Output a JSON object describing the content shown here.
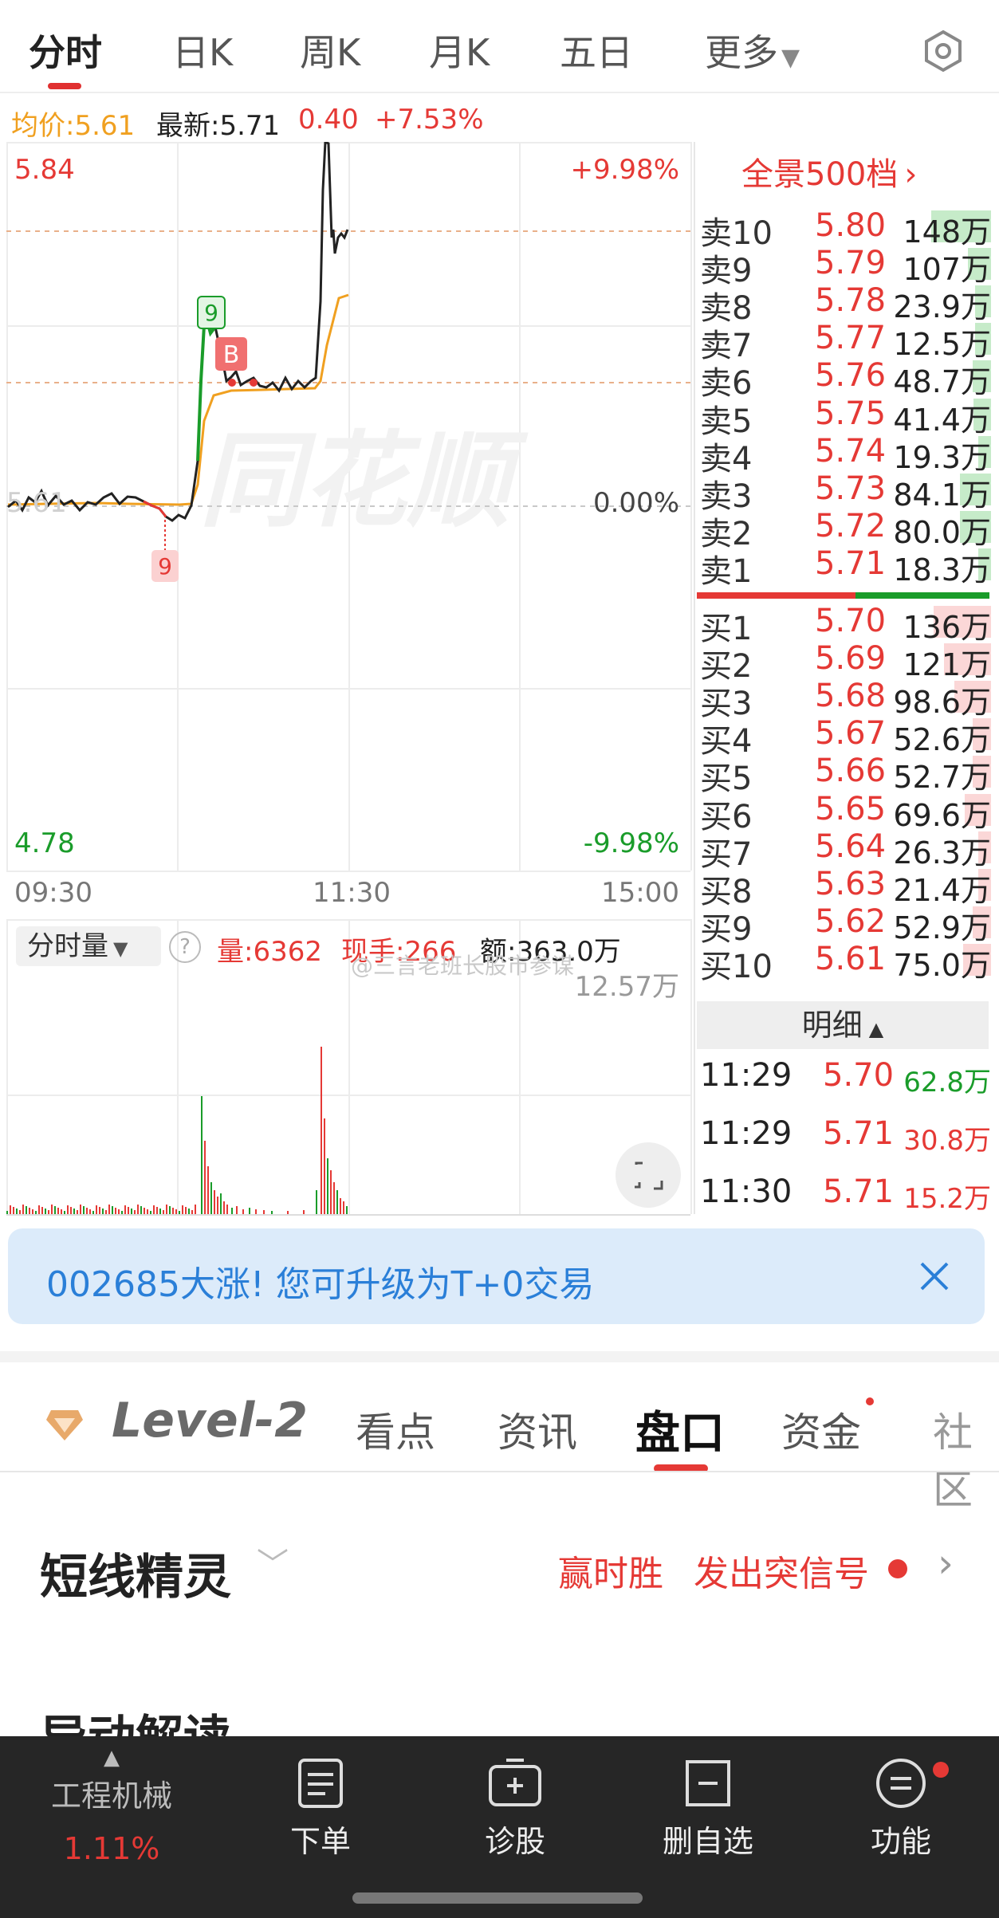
{
  "top_tabs": [
    "分时",
    "日K",
    "周K",
    "月K",
    "五日",
    "更多"
  ],
  "info": {
    "avg_label": "均价:5.61",
    "latest_label": "最新:5.71",
    "change": "0.40",
    "change_pct": "+7.53%"
  },
  "chart": {
    "y_high": "5.84",
    "y_low": "4.78",
    "pct_high": "+9.98%",
    "pct_low": "-9.98%",
    "pct_zero": "0.00%",
    "prev_close": "5.61",
    "x_labels": [
      "09:30",
      "11:30",
      "15:00"
    ],
    "marker_sell": "9",
    "marker_buy": "B",
    "marker_low": "9",
    "watermark": "同花顺"
  },
  "volume": {
    "selector": "分时量",
    "help": "?",
    "vol_label": "量:6362",
    "hand_label": "现手:266",
    "amount_label": "额:363.0万",
    "max_label": "12.57万",
    "watermark": "@三言老班长股市参谋"
  },
  "book": {
    "title": "全景500档",
    "asks": [
      {
        "name": "卖10",
        "price": "5.80",
        "vol": "148万",
        "bar": 0.58
      },
      {
        "name": "卖9",
        "price": "5.79",
        "vol": "107万",
        "bar": 0.22
      },
      {
        "name": "卖8",
        "price": "5.78",
        "vol": "23.9万",
        "bar": 0.15
      },
      {
        "name": "卖7",
        "price": "5.77",
        "vol": "12.5万",
        "bar": 0.15
      },
      {
        "name": "卖6",
        "price": "5.76",
        "vol": "48.7万",
        "bar": 0.18
      },
      {
        "name": "卖5",
        "price": "5.75",
        "vol": "41.4万",
        "bar": 0.17
      },
      {
        "name": "卖4",
        "price": "5.74",
        "vol": "19.3万",
        "bar": 0.12
      },
      {
        "name": "卖3",
        "price": "5.73",
        "vol": "84.1万",
        "bar": 0.3
      },
      {
        "name": "卖2",
        "price": "5.72",
        "vol": "80.0万",
        "bar": 0.3
      },
      {
        "name": "卖1",
        "price": "5.71",
        "vol": "18.3万",
        "bar": 0.12
      }
    ],
    "bids": [
      {
        "name": "买1",
        "price": "5.70",
        "vol": "136万",
        "bar": 0.55
      },
      {
        "name": "买2",
        "price": "5.69",
        "vol": "121万",
        "bar": 0.45
      },
      {
        "name": "买3",
        "price": "5.68",
        "vol": "98.6万",
        "bar": 0.35
      },
      {
        "name": "买4",
        "price": "5.67",
        "vol": "52.6万",
        "bar": 0.18
      },
      {
        "name": "买5",
        "price": "5.66",
        "vol": "52.7万",
        "bar": 0.18
      },
      {
        "name": "买6",
        "price": "5.65",
        "vol": "69.6万",
        "bar": 0.25
      },
      {
        "name": "买7",
        "price": "5.64",
        "vol": "26.3万",
        "bar": 0.12
      },
      {
        "name": "买8",
        "price": "5.63",
        "vol": "21.4万",
        "bar": 0.12
      },
      {
        "name": "买9",
        "price": "5.62",
        "vol": "52.9万",
        "bar": 0.18
      },
      {
        "name": "买10",
        "price": "5.61",
        "vol": "75.0万",
        "bar": 0.27
      }
    ],
    "detail_title": "明细",
    "details": [
      {
        "time": "11:29",
        "price": "5.70",
        "vol": "62.8万",
        "color": "#1a9c2a"
      },
      {
        "time": "11:29",
        "price": "5.71",
        "vol": "30.8万",
        "color": "#e53935"
      },
      {
        "time": "11:30",
        "price": "5.71",
        "vol": "15.2万",
        "color": "#e53935"
      }
    ]
  },
  "banner": {
    "text": "002685大涨!  您可升级为T+0交易"
  },
  "sub_tabs": {
    "level2": "Level-2",
    "items": [
      "看点",
      "资讯",
      "盘口",
      "资金",
      "社区"
    ]
  },
  "section": {
    "title": "短线精灵",
    "tag1": "赢时胜",
    "tag2": "发出突信号",
    "next_title": "异动解读"
  },
  "bottom_nav": {
    "sector_name": "工程机械",
    "sector_pct": "1.11%",
    "items": [
      "下单",
      "诊股",
      "删自选",
      "功能"
    ]
  },
  "colors": {
    "up": "#e53935",
    "down": "#1a9c2a",
    "avg_line": "#f0a020",
    "price_line": "#222222",
    "banner_text": "#2a7fd8"
  }
}
